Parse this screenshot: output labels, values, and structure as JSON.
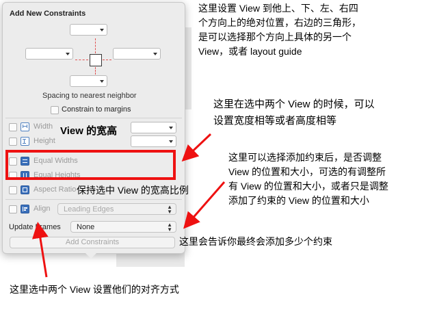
{
  "panel": {
    "title": "Add New Constraints",
    "spacing_caption": "Spacing to nearest neighbor",
    "constrain_margins_label": "Constrain to margins",
    "rows": {
      "width": "Width",
      "height": "Height",
      "equal_widths": "Equal Widths",
      "equal_heights": "Equal Heights",
      "aspect_ratio": "Aspect Ratio",
      "align": "Align",
      "align_value": "Leading Edges"
    },
    "update_frames_label": "Update Frames",
    "update_frames_value": "None",
    "add_button": "Add Constraints"
  },
  "annotations": {
    "top_note": [
      "这里设置 View 到他上、下、左、右四",
      "个方向上的绝对位置，右边的三角形，",
      "是可以选择那个方向上具体的另一个",
      "View，或者 layout guide"
    ],
    "equal_note": [
      "这里在选中两个 View 的时候，可以",
      "设置宽度相等或者高度相等"
    ],
    "size_label": "View 的宽高",
    "ratio_label": "保持选中 View 的宽高比例",
    "update_note": [
      "这里可以选择添加约束后，是否调整",
      "View 的位置和大小，可选的有调整所",
      "有 View 的位置和大小，或者只是调整",
      "添加了约束的 View 的位置和大小"
    ],
    "final_note": "这里会告诉你最终会添加多少个约束",
    "align_note": "这里选中两个 View 设置他们的对齐方式"
  },
  "colors": {
    "highlight_red": "#ee1111",
    "icon_blue": "#3a6fba",
    "panel_bg": "#ececec"
  }
}
